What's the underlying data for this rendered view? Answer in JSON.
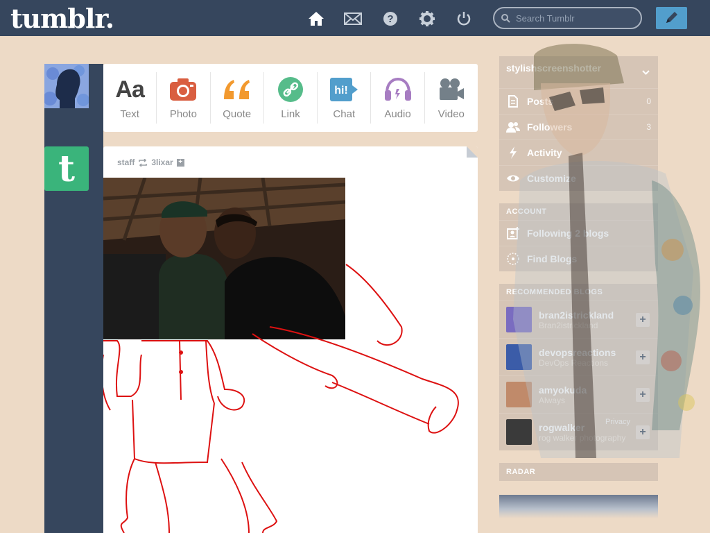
{
  "header": {
    "logo": "tumblr.",
    "search_placeholder": "Search Tumblr",
    "icons": [
      "home-icon",
      "mail-icon",
      "help-icon",
      "gear-icon",
      "power-icon"
    ]
  },
  "post_types": [
    {
      "label": "Text",
      "icon": "text-icon",
      "color": "#444444"
    },
    {
      "label": "Photo",
      "icon": "camera-icon",
      "color": "#d95e40"
    },
    {
      "label": "Quote",
      "icon": "quote-icon",
      "color": "#f2992e"
    },
    {
      "label": "Link",
      "icon": "link-icon",
      "color": "#56bc8a"
    },
    {
      "label": "Chat",
      "icon": "chat-icon",
      "color": "#529ecc"
    },
    {
      "label": "Audio",
      "icon": "headphones-icon",
      "color": "#a77dc2"
    },
    {
      "label": "Video",
      "icon": "video-camera-icon",
      "color": "#748089"
    }
  ],
  "post": {
    "author": "staff",
    "reblogged_from": "3lixar"
  },
  "sidebar": {
    "blog_name": "stylishscreenshotter",
    "menu": [
      {
        "label": "Posts",
        "count": "0",
        "icon": "document-icon"
      },
      {
        "label": "Followers",
        "count": "3",
        "icon": "people-icon"
      },
      {
        "label": "Activity",
        "count": "",
        "icon": "lightning-icon"
      },
      {
        "label": "Customize",
        "count": "",
        "icon": "eye-icon"
      }
    ],
    "account_title": "ACCOUNT",
    "account_items": [
      {
        "label": "Following 2 blogs",
        "icon": "add-person-icon"
      },
      {
        "label": "Find Blogs",
        "icon": "compass-icon"
      }
    ],
    "recommended_title": "RECOMMENDED BLOGS",
    "recommended": [
      {
        "name": "bran2istrickland",
        "sub": "Bran2istrickland",
        "color": "#7a6cc0"
      },
      {
        "name": "devopsreactions",
        "sub": "DevOps Reactions",
        "color": "#3b5ca8"
      },
      {
        "name": "amyokuda",
        "sub": "Always",
        "color": "#c08a6a"
      },
      {
        "name": "rogwalker",
        "sub": "rog walker photography",
        "color": "#3a3a3a"
      }
    ],
    "radar_title": "RADAR",
    "privacy": "Privacy"
  }
}
